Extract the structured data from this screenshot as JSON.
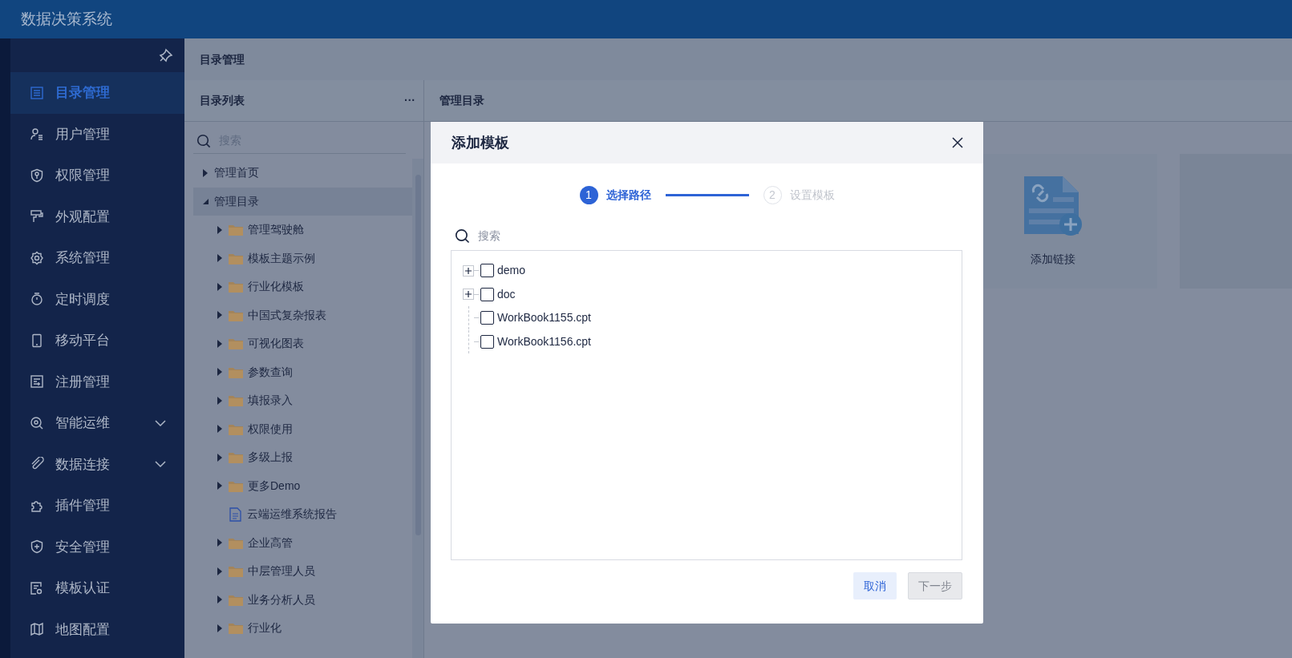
{
  "app": {
    "title": "数据决策系统"
  },
  "sidebar": {
    "items": [
      {
        "label": "目录管理",
        "selected": true,
        "expandable": false
      },
      {
        "label": "用户管理",
        "selected": false,
        "expandable": false
      },
      {
        "label": "权限管理",
        "selected": false,
        "expandable": false
      },
      {
        "label": "外观配置",
        "selected": false,
        "expandable": false
      },
      {
        "label": "系统管理",
        "selected": false,
        "expandable": false
      },
      {
        "label": "定时调度",
        "selected": false,
        "expandable": false
      },
      {
        "label": "移动平台",
        "selected": false,
        "expandable": false
      },
      {
        "label": "注册管理",
        "selected": false,
        "expandable": false
      },
      {
        "label": "智能运维",
        "selected": false,
        "expandable": true
      },
      {
        "label": "数据连接",
        "selected": false,
        "expandable": true
      },
      {
        "label": "插件管理",
        "selected": false,
        "expandable": false
      },
      {
        "label": "安全管理",
        "selected": false,
        "expandable": false
      },
      {
        "label": "模板认证",
        "selected": false,
        "expandable": false
      },
      {
        "label": "地图配置",
        "selected": false,
        "expandable": false
      }
    ]
  },
  "breadcrumb": "目录管理",
  "directory_panel": {
    "title": "目录列表",
    "more": "···",
    "search": {
      "placeholder": "搜索"
    },
    "tree": [
      {
        "label": "管理首页",
        "expanded": false,
        "selected": false
      },
      {
        "label": "管理目录",
        "expanded": true,
        "selected": true,
        "children": [
          {
            "label": "管理驾驶舱",
            "kind": "folder",
            "expanded": false,
            "selected": false
          },
          {
            "label": "模板主题示例",
            "kind": "folder",
            "expanded": false,
            "selected": false
          },
          {
            "label": "行业化模板",
            "kind": "folder",
            "expanded": false,
            "selected": false
          },
          {
            "label": "中国式复杂报表",
            "kind": "folder",
            "expanded": false,
            "selected": false
          },
          {
            "label": "可视化图表",
            "kind": "folder",
            "expanded": false,
            "selected": false
          },
          {
            "label": "参数查询",
            "kind": "folder",
            "expanded": false,
            "selected": false
          },
          {
            "label": "填报录入",
            "kind": "folder",
            "expanded": false,
            "selected": false
          },
          {
            "label": "权限使用",
            "kind": "folder",
            "expanded": false,
            "selected": false
          },
          {
            "label": "多级上报",
            "kind": "folder",
            "expanded": false,
            "selected": false
          },
          {
            "label": "更多Demo",
            "kind": "folder",
            "expanded": false,
            "selected": false
          },
          {
            "label": "云端运维系统报告",
            "kind": "file",
            "expanded": false,
            "selected": false
          },
          {
            "label": "企业高管",
            "kind": "folder",
            "expanded": false,
            "selected": false
          },
          {
            "label": "中层管理人员",
            "kind": "folder",
            "expanded": false,
            "selected": false
          },
          {
            "label": "业务分析人员",
            "kind": "folder",
            "expanded": false,
            "selected": false
          },
          {
            "label": "行业化",
            "kind": "folder",
            "expanded": false,
            "selected": false
          }
        ]
      }
    ]
  },
  "manage_panel": {
    "title": "管理目录",
    "cards": [
      {
        "label": "添加链接",
        "kind": "link"
      },
      {
        "kind": "blank"
      }
    ]
  },
  "dialog": {
    "title": "添加模板",
    "steps": [
      {
        "number": "1",
        "label": "选择路径",
        "current": true
      },
      {
        "number": "2",
        "label": "设置模板",
        "current": false
      }
    ],
    "search": {
      "placeholder": "搜索"
    },
    "tree": [
      {
        "label": "demo",
        "kind": "folder",
        "expanded": false,
        "checked": false
      },
      {
        "label": "doc",
        "kind": "folder",
        "expanded": false,
        "checked": false
      },
      {
        "label": "WorkBook1155.cpt",
        "kind": "file",
        "checked": false
      },
      {
        "label": "WorkBook1156.cpt",
        "kind": "file",
        "checked": false
      }
    ],
    "buttons": [
      {
        "label": "取消",
        "disabled": false,
        "kind": "secondary"
      },
      {
        "label": "下一步",
        "disabled": true,
        "kind": "primary"
      }
    ]
  }
}
